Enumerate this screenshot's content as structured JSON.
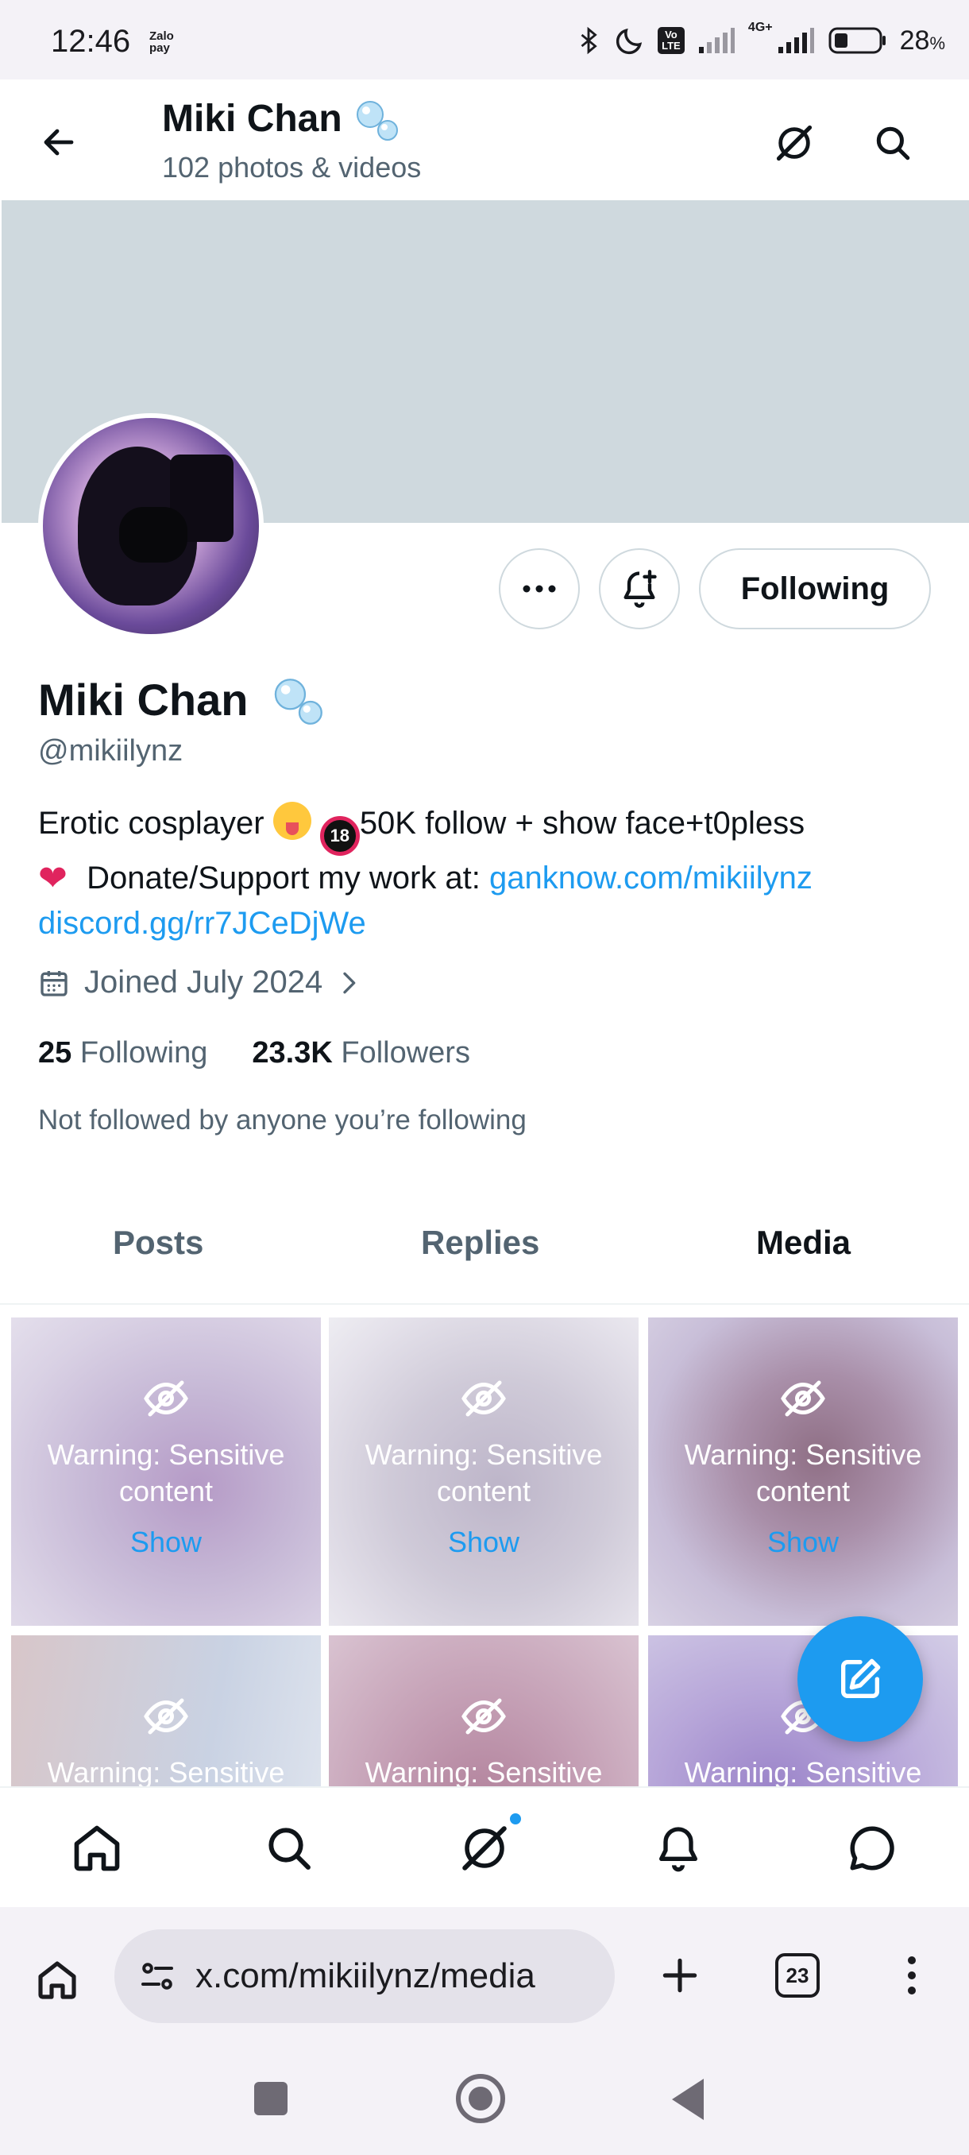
{
  "status_bar": {
    "time": "12:46",
    "zalo_label": "Zalo pay",
    "battery_percent": "28",
    "battery_unit": "%",
    "network_badge": "Vo LTE",
    "network_type": "4G+"
  },
  "header": {
    "title": "Miki Chan",
    "subtitle": "102 photos & videos"
  },
  "profile": {
    "name": "Miki Chan",
    "handle": "@mikiilynz",
    "bio_line1_text": "Erotic cosplayer",
    "bio_line1_rest": "50K follow + show face+t0pless",
    "bio_line2_text": "Donate/Support my work at:",
    "bio_link1": "ganknow.com/mikiilynz",
    "bio_link2": "discord.gg/rr7JCeDjWe",
    "adult_badge": "18",
    "joined": "Joined July 2024",
    "following_count": "25",
    "following_label": "Following",
    "followers_count": "23.3K",
    "followers_label": "Followers",
    "not_followed": "Not followed by anyone you’re following"
  },
  "actions": {
    "follow_button": "Following"
  },
  "tabs": [
    {
      "label": "Posts",
      "active": false
    },
    {
      "label": "Replies",
      "active": false
    },
    {
      "label": "Media",
      "active": true
    }
  ],
  "media": {
    "warning": "Warning: Sensitive content",
    "warning_line1": "Warning: Sensitive",
    "warning_line2": "content",
    "show_label": "Show"
  },
  "browser": {
    "url": "x.com/mikiilynz/media",
    "tab_count": "23"
  },
  "colors": {
    "accent": "#1d9bf0",
    "banner": "#cfd9de",
    "secondary_text": "#536471"
  }
}
